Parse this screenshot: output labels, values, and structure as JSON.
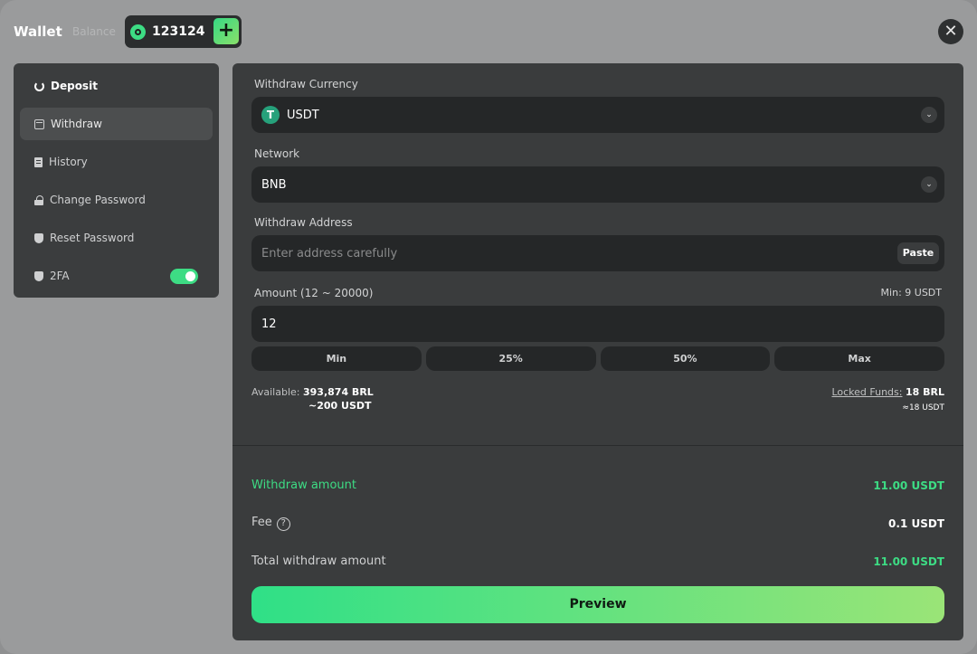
{
  "header": {
    "title": "Wallet",
    "balance_label": "Balance",
    "balance_value": "123124",
    "add_label": "+",
    "close_label": "✕"
  },
  "sidebar": {
    "items": [
      {
        "label": "Deposit",
        "icon": "refresh-icon"
      },
      {
        "label": "Withdraw",
        "icon": "wallet-icon"
      },
      {
        "label": "History",
        "icon": "document-icon"
      },
      {
        "label": "Change Password",
        "icon": "lock-icon"
      },
      {
        "label": "Reset Password",
        "icon": "shield-icon"
      },
      {
        "label": "2FA",
        "icon": "shield-check-icon",
        "toggle_on": true
      }
    ]
  },
  "form": {
    "currency_label": "Withdraw Currency",
    "currency_value": "USDT",
    "currency_icon": "T",
    "network_label": "Network",
    "network_value": "BNB",
    "address_label": "Withdraw Address",
    "address_placeholder": "Enter address carefully",
    "paste_label": "Paste",
    "amount_label": "Amount (12 ~ 20000)",
    "min_note": "Min: 9 USDT",
    "amount_value": "12",
    "quick": [
      "Min",
      "25%",
      "50%",
      "Max"
    ],
    "available_label": "Available:",
    "available_brl": "393,874 BRL",
    "available_usdt": "~200 USDT",
    "locked_label": "Locked Funds:",
    "locked_brl": "18 BRL",
    "locked_usdt": "≈18 USDT"
  },
  "summary": {
    "withdraw_label": "Withdraw amount",
    "withdraw_value": "11.00 USDT",
    "fee_label": "Fee",
    "fee_value": "0.1 USDT",
    "total_label": "Total withdraw amount",
    "total_value": "11.00 USDT"
  },
  "preview_label": "Preview",
  "colors": {
    "accent": "#3ddc84",
    "panel": "#3a3c3d",
    "field": "#252728"
  }
}
